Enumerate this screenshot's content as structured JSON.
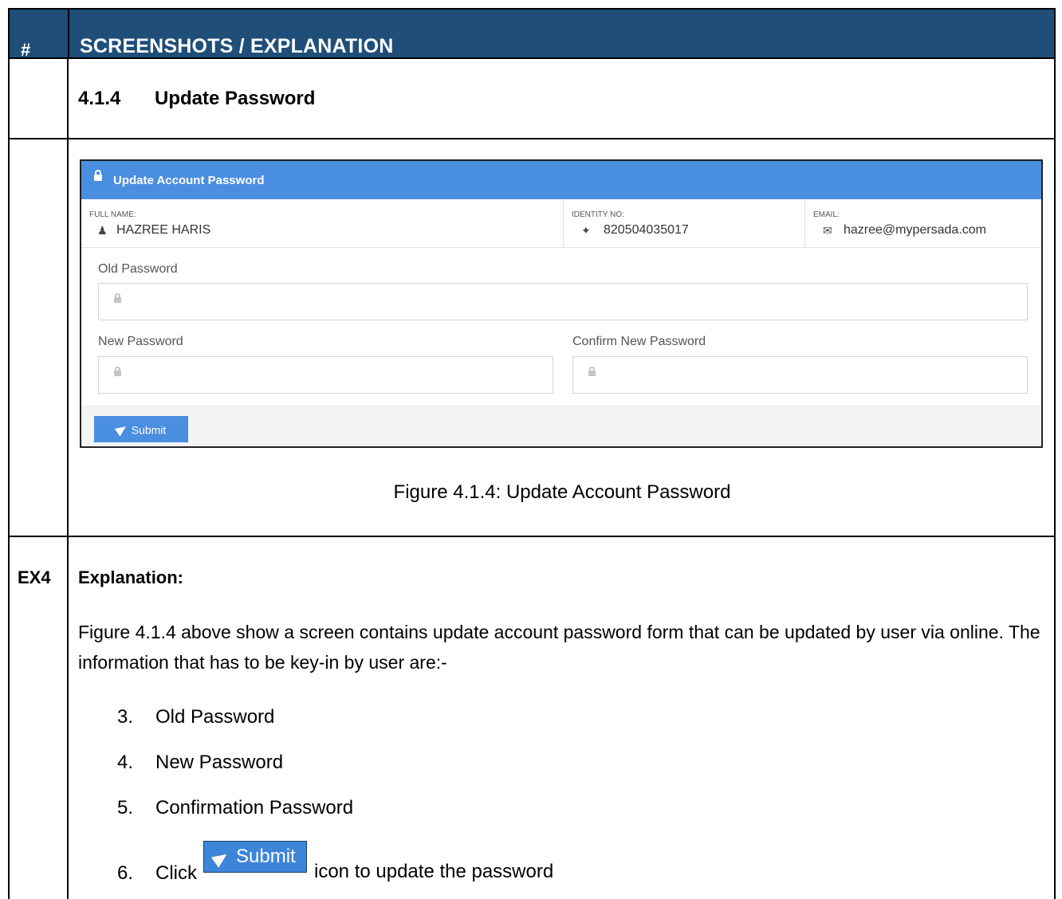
{
  "header": {
    "num": "#",
    "title": "SCREENSHOTS / EXPLANATION"
  },
  "section": {
    "number": "4.1.4",
    "title": "Update Password"
  },
  "screenshot": {
    "bar_title": "Update Account Password",
    "full_name_label": "FULL NAME:",
    "full_name": "HAZREE HARIS",
    "identity_label": "IDENTITY NO:",
    "identity": "820504035017",
    "email_label": "EMAIL:",
    "email": "hazree@mypersada.com",
    "old_label": "Old Password",
    "new_label": "New Password",
    "confirm_label": "Confirm New Password",
    "submit": "Submit",
    "accent": "#4a8ee0"
  },
  "caption": "Figure 4.1.4: Update Account Password",
  "ex": {
    "id": "EX4",
    "heading": "Explanation:",
    "paragraph": "Figure 4.1.4 above show a screen contains update account password form that can be updated by user via online. The information that has to be key-in by user are:-",
    "items": [
      {
        "n": "3.",
        "text": "Old Password"
      },
      {
        "n": "4.",
        "text": "New Password"
      },
      {
        "n": "5.",
        "text": "Confirmation Password"
      }
    ],
    "last_n": "6.",
    "last_pre": "Click",
    "last_btn": "Submit",
    "last_post": "icon to update the password"
  },
  "colors": {
    "header_bg": "#1f4e79"
  }
}
